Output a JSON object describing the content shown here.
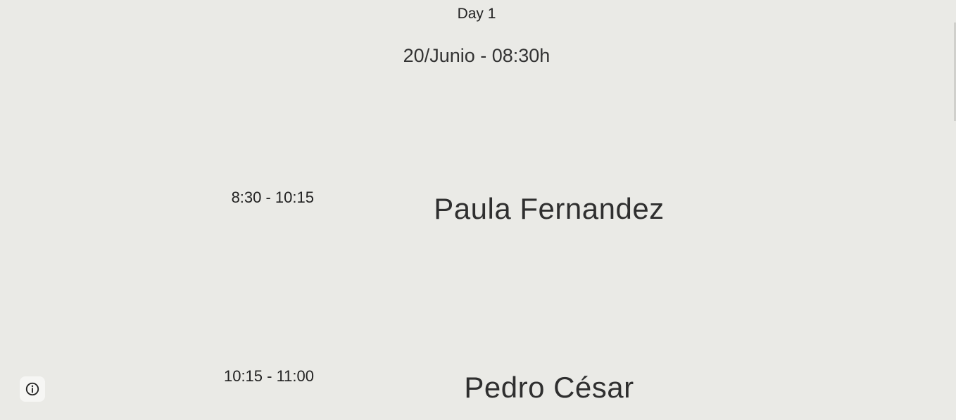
{
  "header": {
    "day_label": "Day 1",
    "date_label": "20/Junio - 08:30h"
  },
  "schedule": [
    {
      "time": "8:30 - 10:15",
      "speaker": "Paula Fernandez"
    },
    {
      "time": "10:15 - 11:00",
      "speaker": "Pedro César"
    }
  ],
  "icons": {
    "info_button": "info-icon"
  },
  "colors": {
    "background": "#eaeae6",
    "text": "#222222"
  }
}
